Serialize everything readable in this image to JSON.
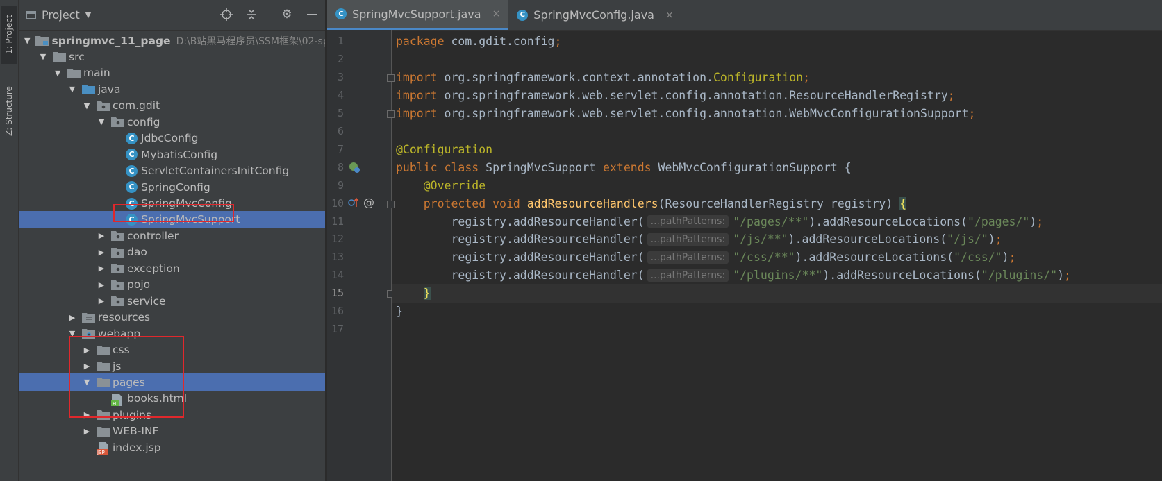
{
  "sidebar_strip": {
    "project_tab": "1: Project",
    "structure_tab": "Z: Structure"
  },
  "project_panel": {
    "title": "Project",
    "tree": [
      {
        "label": "springmvc_11_page",
        "path": "D:\\B站黑马程序员\\SSM框架\\02-sp",
        "depth": 0,
        "arrow": "open",
        "icon": "module",
        "bold": true
      },
      {
        "label": "src",
        "depth": 1,
        "arrow": "open",
        "icon": "folder"
      },
      {
        "label": "main",
        "depth": 2,
        "arrow": "open",
        "icon": "folder"
      },
      {
        "label": "java",
        "depth": 3,
        "arrow": "open",
        "icon": "source-folder"
      },
      {
        "label": "com.gdit",
        "depth": 4,
        "arrow": "open",
        "icon": "package"
      },
      {
        "label": "config",
        "depth": 5,
        "arrow": "open",
        "icon": "package"
      },
      {
        "label": "JdbcConfig",
        "depth": 6,
        "arrow": "none",
        "icon": "class"
      },
      {
        "label": "MybatisConfig",
        "depth": 6,
        "arrow": "none",
        "icon": "class"
      },
      {
        "label": "ServletContainersInitConfig",
        "depth": 6,
        "arrow": "none",
        "icon": "class"
      },
      {
        "label": "SpringConfig",
        "depth": 6,
        "arrow": "none",
        "icon": "class"
      },
      {
        "label": "SpringMvcConfig",
        "depth": 6,
        "arrow": "none",
        "icon": "class"
      },
      {
        "label": "SpringMvcSupport",
        "depth": 6,
        "arrow": "none",
        "icon": "class",
        "selected": true
      },
      {
        "label": "controller",
        "depth": 5,
        "arrow": "closed",
        "icon": "package"
      },
      {
        "label": "dao",
        "depth": 5,
        "arrow": "closed",
        "icon": "package"
      },
      {
        "label": "exception",
        "depth": 5,
        "arrow": "closed",
        "icon": "package"
      },
      {
        "label": "pojo",
        "depth": 5,
        "arrow": "closed",
        "icon": "package"
      },
      {
        "label": "service",
        "depth": 5,
        "arrow": "closed",
        "icon": "package"
      },
      {
        "label": "resources",
        "depth": 3,
        "arrow": "closed",
        "icon": "resources-folder"
      },
      {
        "label": "webapp",
        "depth": 3,
        "arrow": "open",
        "icon": "web-folder"
      },
      {
        "label": "css",
        "depth": 4,
        "arrow": "closed",
        "icon": "folder"
      },
      {
        "label": "js",
        "depth": 4,
        "arrow": "closed",
        "icon": "folder"
      },
      {
        "label": "pages",
        "depth": 4,
        "arrow": "open",
        "icon": "folder",
        "selected": true
      },
      {
        "label": "books.html",
        "depth": 5,
        "arrow": "none",
        "icon": "html-file"
      },
      {
        "label": "plugins",
        "depth": 4,
        "arrow": "closed",
        "icon": "folder"
      },
      {
        "label": "WEB-INF",
        "depth": 4,
        "arrow": "closed",
        "icon": "folder"
      },
      {
        "label": "index.jsp",
        "depth": 4,
        "arrow": "none",
        "icon": "jsp-file"
      }
    ]
  },
  "editor": {
    "tabs": [
      {
        "label": "SpringMvcSupport.java",
        "active": true,
        "close": "×"
      },
      {
        "label": "SpringMvcConfig.java",
        "active": false,
        "close": "×"
      }
    ],
    "current_line": 15,
    "lines": [
      [
        [
          "kw",
          "package "
        ],
        [
          "pl",
          "com.gdit.config"
        ],
        [
          "kw",
          ";"
        ]
      ],
      [],
      [
        [
          "kw",
          "import "
        ],
        [
          "pl",
          "org.springframework.context.annotation."
        ],
        [
          "an",
          "Configuration"
        ],
        [
          "kw",
          ";"
        ]
      ],
      [
        [
          "kw",
          "import "
        ],
        [
          "pl",
          "org.springframework.web.servlet.config.annotation.ResourceHandlerRegistry"
        ],
        [
          "kw",
          ";"
        ]
      ],
      [
        [
          "kw",
          "import "
        ],
        [
          "pl",
          "org.springframework.web.servlet.config.annotation.WebMvcConfigurationSupport"
        ],
        [
          "kw",
          ";"
        ]
      ],
      [],
      [
        [
          "an",
          "@Configuration"
        ]
      ],
      [
        [
          "kw",
          "public class "
        ],
        [
          "pl",
          "SpringMvcSupport "
        ],
        [
          "kw",
          "extends "
        ],
        [
          "pl",
          "WebMvcConfigurationSupport {"
        ]
      ],
      [
        [
          "pl",
          "    "
        ],
        [
          "an",
          "@Override"
        ]
      ],
      [
        [
          "pl",
          "    "
        ],
        [
          "kw",
          "protected void "
        ],
        [
          "fn",
          "addResourceHandlers"
        ],
        [
          "pl",
          "(ResourceHandlerRegistry registry) "
        ],
        [
          "brace",
          "{"
        ]
      ],
      [
        [
          "pl",
          "        registry.addResourceHandler("
        ],
        [
          "hint",
          "...pathPatterns:"
        ],
        [
          "str",
          "\"/pages/**\""
        ],
        [
          "pl",
          ").addResourceLocations("
        ],
        [
          "str",
          "\"/pages/\""
        ],
        [
          "pl",
          ")"
        ],
        [
          "kw",
          ";"
        ]
      ],
      [
        [
          "pl",
          "        registry.addResourceHandler("
        ],
        [
          "hint",
          "...pathPatterns:"
        ],
        [
          "str",
          "\"/js/**\""
        ],
        [
          "pl",
          ").addResourceLocations("
        ],
        [
          "str",
          "\"/js/\""
        ],
        [
          "pl",
          ")"
        ],
        [
          "kw",
          ";"
        ]
      ],
      [
        [
          "pl",
          "        registry.addResourceHandler("
        ],
        [
          "hint",
          "...pathPatterns:"
        ],
        [
          "str",
          "\"/css/**\""
        ],
        [
          "pl",
          ").addResourceLocations("
        ],
        [
          "str",
          "\"/css/\""
        ],
        [
          "pl",
          ")"
        ],
        [
          "kw",
          ";"
        ]
      ],
      [
        [
          "pl",
          "        registry.addResourceHandler("
        ],
        [
          "hint",
          "...pathPatterns:"
        ],
        [
          "str",
          "\"/plugins/**\""
        ],
        [
          "pl",
          ").addResourceLocations("
        ],
        [
          "str",
          "\"/plugins/\""
        ],
        [
          "pl",
          ")"
        ],
        [
          "kw",
          ";"
        ]
      ],
      [
        [
          "pl",
          "    "
        ],
        [
          "brace",
          "}"
        ]
      ],
      [
        [
          "pl",
          "}"
        ]
      ],
      []
    ]
  },
  "colors": {
    "selection": "#4b6eaf",
    "highlight_box": "#e0282c",
    "keyword": "#cc7832",
    "annotation": "#bbb529",
    "string": "#6a8759",
    "method": "#ffc66d"
  }
}
